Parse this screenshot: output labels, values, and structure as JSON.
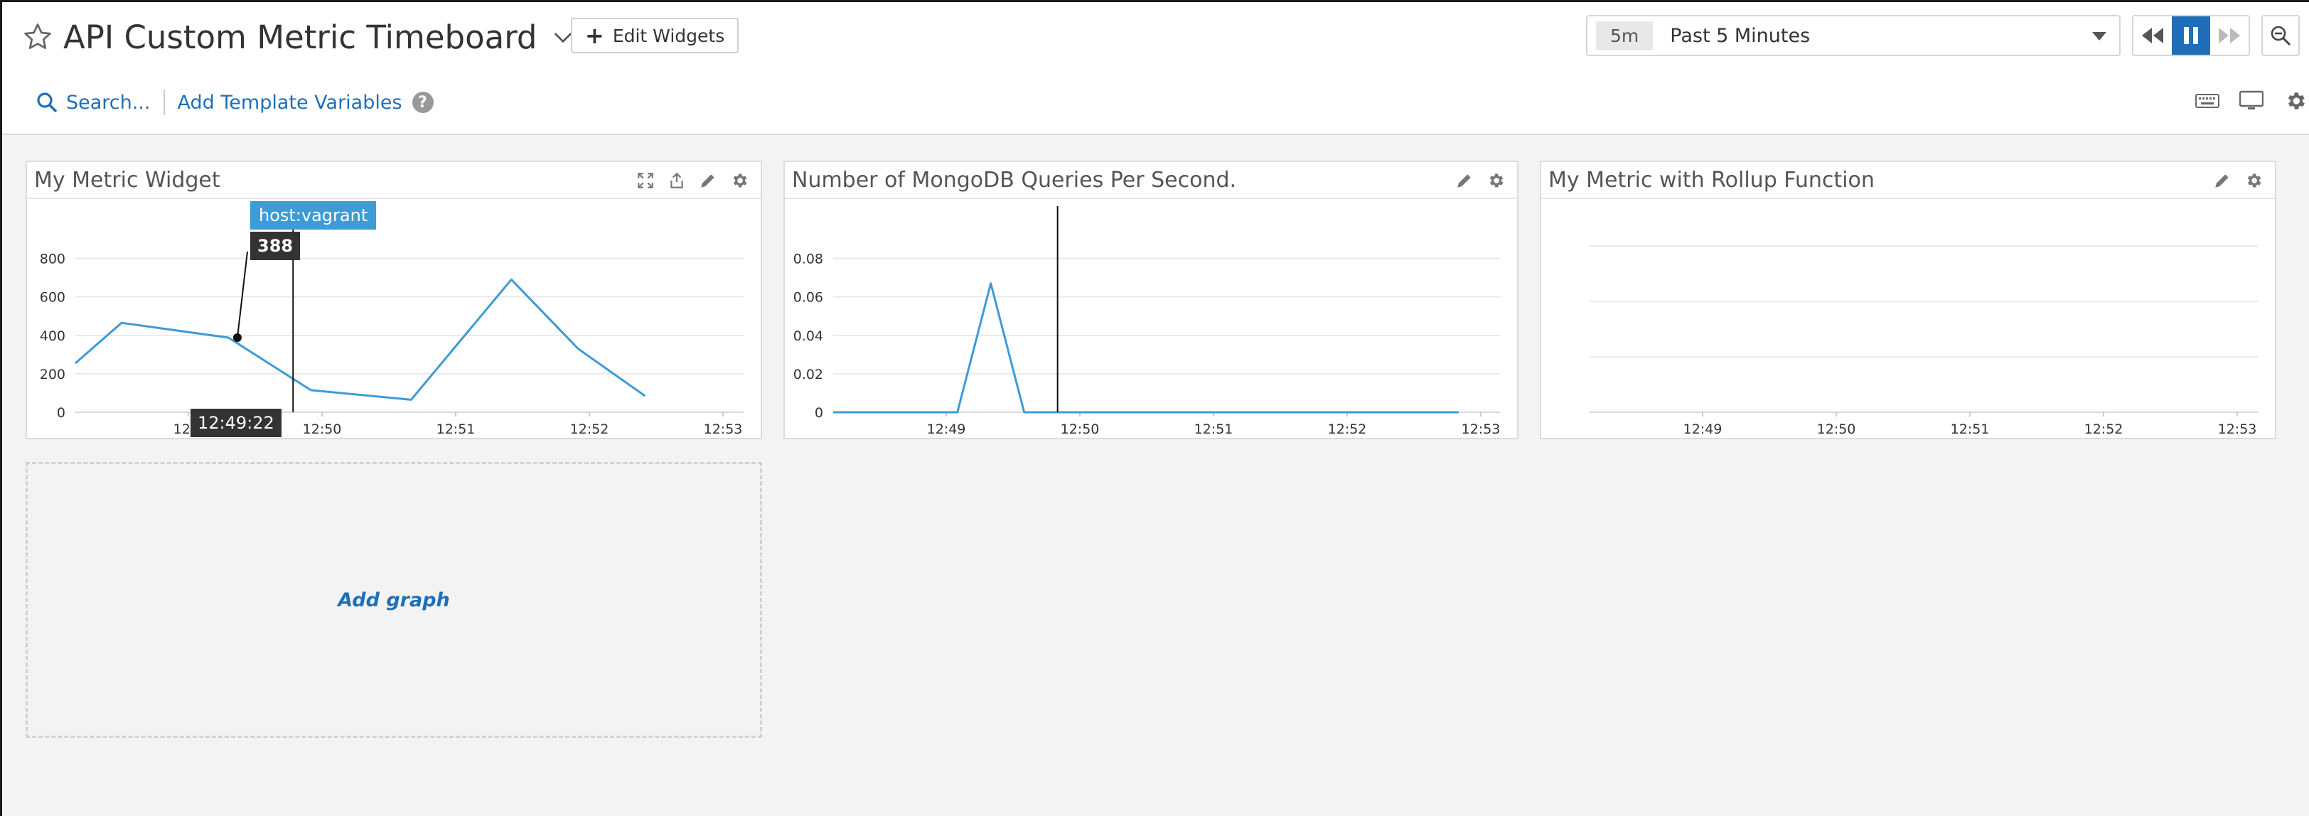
{
  "header": {
    "title": "API Custom Metric Timeboard",
    "edit_widgets_label": "Edit Widgets",
    "time_badge": "5m",
    "time_range_label": "Past 5 Minutes",
    "search_label": "Search...",
    "template_vars_label": "Add Template Variables",
    "help_label": "?"
  },
  "colors": {
    "accent": "#1f6fb8",
    "series": "#3d9bd6",
    "tooltip_dark": "#333333"
  },
  "widgets": [
    {
      "title": "My Metric Widget",
      "icons": [
        "expand-icon",
        "export-icon",
        "pencil-icon",
        "gear-icon"
      ]
    },
    {
      "title": "Number of MongoDB Queries Per Second.",
      "icons": [
        "pencil-icon",
        "gear-icon"
      ]
    },
    {
      "title": "My Metric with Rollup Function",
      "icons": [
        "pencil-icon",
        "gear-icon"
      ]
    }
  ],
  "tooltip": {
    "host": "host:vagrant",
    "value": "388",
    "time": "12:49:22"
  },
  "add_graph_label": "Add graph",
  "chart_data": [
    {
      "type": "line",
      "title": "My Metric Widget",
      "x": [
        "12:48:05",
        "12:48:30",
        "12:49:18",
        "12:49:55",
        "12:50:40",
        "12:51:25",
        "12:51:55",
        "12:52:25"
      ],
      "series": [
        {
          "values": [
            255,
            465,
            388,
            115,
            65,
            690,
            330,
            85
          ]
        }
      ],
      "y_ticks": [
        "0",
        "200",
        "400",
        "600",
        "800"
      ],
      "x_ticks": [
        "12:4",
        "12:50",
        "12:51",
        "12:52",
        "12:53"
      ],
      "ylim": [
        0,
        850
      ],
      "grid": true
    },
    {
      "type": "line",
      "title": "Number of MongoDB Queries Per Second.",
      "x": [
        "12:48",
        "12:49:05",
        "12:49:20",
        "12:49:35",
        "12:52:50"
      ],
      "series": [
        {
          "values": [
            0,
            0,
            0.067,
            0,
            0
          ]
        }
      ],
      "y_ticks": [
        "0",
        "0.02",
        "0.04",
        "0.06",
        "0.08"
      ],
      "x_ticks": [
        "12:49",
        "12:50",
        "12:51",
        "12:52",
        "12:53"
      ],
      "ylim": [
        0,
        0.085
      ],
      "grid": true
    },
    {
      "type": "line",
      "title": "My Metric with Rollup Function",
      "series": [],
      "x_ticks": [
        "12:49",
        "12:50",
        "12:51",
        "12:52",
        "12:53"
      ],
      "grid": true
    }
  ]
}
